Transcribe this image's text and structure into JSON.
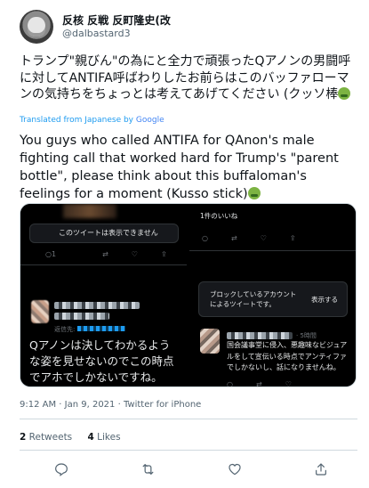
{
  "author": {
    "display_name": "反核 反戦 反町隆史(改",
    "handle": "@dalbastard3"
  },
  "tweet": {
    "original_text": "トランプ\"親びん\"の為にと全力で頑張ったQアノンの男闘呼に対してANTIFA呼ばわりしたお前らはこのバッファローマンの気持ちをちょっとは考えてあげてください (クッソ棒",
    "translated_from": "Translated from Japanese by",
    "translation_provider": "Google",
    "translated_text": "You guys who called ANTIFA for QAnon's male fighting call that worked hard for Trump's \"parent bottle\", please think about this buffaloman's feelings for a moment (Kusso stick)"
  },
  "media": {
    "left": {
      "hidden_notice": "このツイートは表示できません",
      "mini_count": "1",
      "reply_to_prefix": "返信先:",
      "reply_body": "Qアノンは決してわかるような姿を見せないのでこの時点でアホでしかないですね。"
    },
    "right": {
      "likes_header": "1件のいいね",
      "blocked_notice": "ブロックしているアカウントによるツイートです。",
      "show_button": "表示する",
      "time_ago": "· 5時間",
      "reply_body": "国会議事堂に侵入、悪趣味なビジュアルをして宣伝いる時点でアンティファでしかないし、話になりませんね。"
    }
  },
  "meta": {
    "timestamp": "9:12 AM · Jan 9, 2021 · Twitter for iPhone"
  },
  "stats": {
    "retweets_count": "2",
    "retweets_label": "Retweets",
    "likes_count": "4",
    "likes_label": "Likes"
  },
  "actions": [
    "reply-icon",
    "retweet-icon",
    "like-icon",
    "share-icon"
  ],
  "colors": {
    "link_blue": "#1d9bf0",
    "text_gray": "#536471",
    "border": "#cfd9de"
  }
}
